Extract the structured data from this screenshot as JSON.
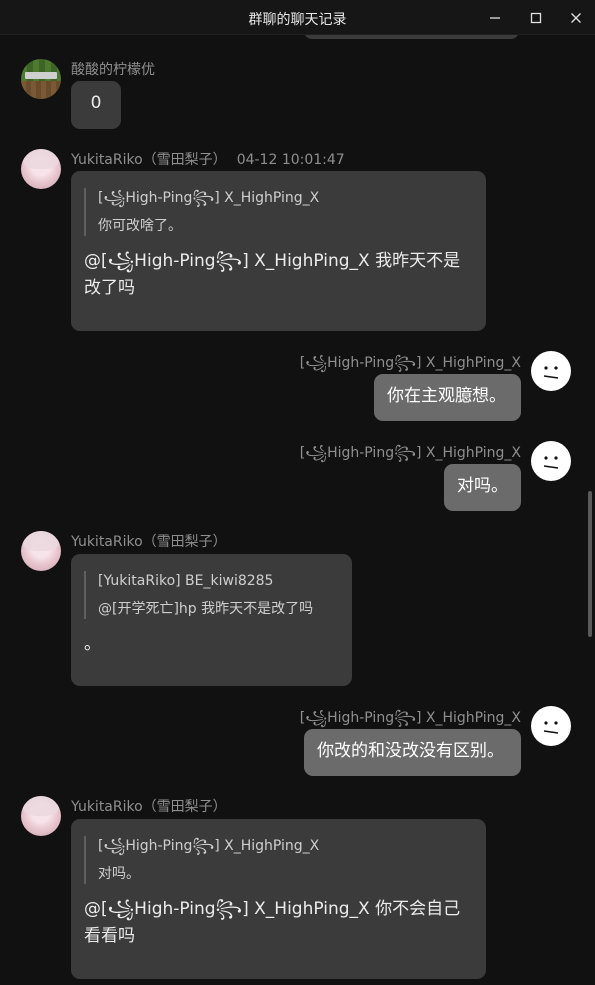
{
  "window": {
    "title": "群聊的聊天记录",
    "minimize_icon": "minimize-icon",
    "maximize_icon": "maximize-icon",
    "close_icon": "close-icon"
  },
  "messages": [
    {
      "side": "left",
      "avatar": "minecraft-avatar",
      "sender": "酸酸的柠檬优",
      "text": "0"
    },
    {
      "side": "left",
      "avatar": "anime-girl-avatar",
      "sender": "YukitaRiko（雪田梨子）",
      "time": "04-12 10:01:47",
      "quote_author": "[꧁High-Ping꧂] X_HighPing_X",
      "quote_text": "你可改啥了。",
      "text": "@[꧁High-Ping꧂] X_HighPing_X 我昨天不是改了吗"
    },
    {
      "side": "right",
      "avatar": "smiley-face-avatar",
      "sender": "[꧁High-Ping꧂] X_HighPing_X",
      "text": "你在主观臆想。"
    },
    {
      "side": "right",
      "avatar": "smiley-face-avatar",
      "sender": "[꧁High-Ping꧂] X_HighPing_X",
      "text": "对吗。"
    },
    {
      "side": "left",
      "avatar": "anime-girl-avatar",
      "sender": "YukitaRiko（雪田梨子）",
      "quote_author": "[YukitaRiko] BE_kiwi8285",
      "quote_text": "@[开学死亡]hp 我昨天不是改了吗",
      "text": "。"
    },
    {
      "side": "right",
      "avatar": "smiley-face-avatar",
      "sender": "[꧁High-Ping꧂] X_HighPing_X",
      "text": "你改的和没改没有区别。"
    },
    {
      "side": "left",
      "avatar": "anime-girl-avatar",
      "sender": "YukitaRiko（雪田梨子）",
      "quote_author": "[꧁High-Ping꧂] X_HighPing_X",
      "quote_text": "对吗。",
      "text": "@[꧁High-Ping꧂] X_HighPing_X 你不会自己看看吗"
    }
  ],
  "colors": {
    "background": "#111111",
    "bubble_other": "#3b3b3b",
    "bubble_mine": "#6b6b6b",
    "sender_text": "#8f8f8f"
  }
}
